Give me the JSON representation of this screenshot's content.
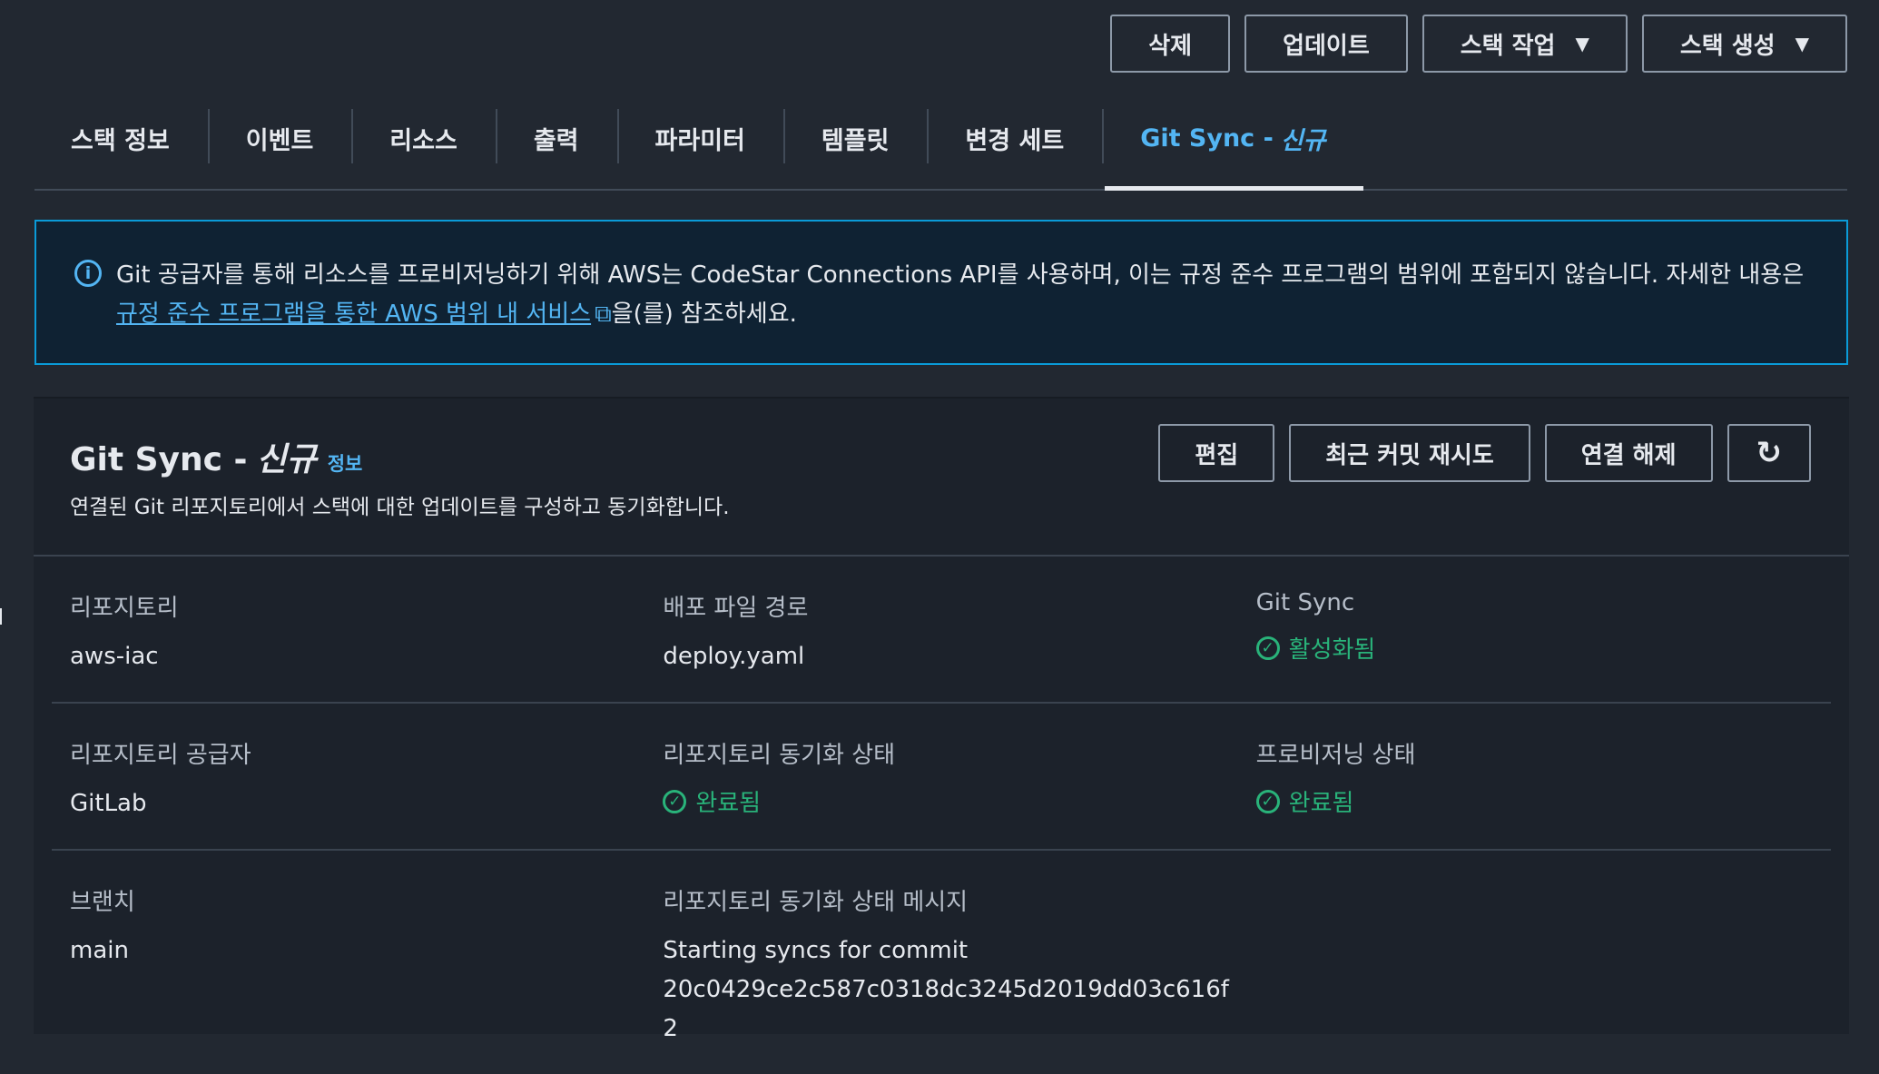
{
  "header_actions": {
    "delete": "삭제",
    "update": "업데이트",
    "stack_actions": "스택 작업",
    "create_stack": "스택 생성"
  },
  "tabs": [
    {
      "label": "스택 정보"
    },
    {
      "label": "이벤트"
    },
    {
      "label": "리소스"
    },
    {
      "label": "출력"
    },
    {
      "label": "파라미터"
    },
    {
      "label": "템플릿"
    },
    {
      "label": "변경 세트"
    },
    {
      "label": "Git Sync -",
      "badge": "신규"
    }
  ],
  "alert": {
    "text": "Git 공급자를 통해 리소스를 프로비저닝하기 위해 AWS는 CodeStar Connections API를 사용하며, 이는 규정 준수 프로그램의 범위에 포함되지 않습니다. 자세한 내용은",
    "link": "규정 준수 프로그램을 통한 AWS 범위 내 서비스",
    "suffix": "을(를) 참조하세요."
  },
  "panel": {
    "title": "Git Sync -",
    "title_badge": "신규",
    "info_link": "정보",
    "description": "연결된 Git 리포지토리에서 스택에 대한 업데이트를 구성하고 동기화합니다.",
    "actions": {
      "edit": "편집",
      "retry_last_commit": "최근 커밋 재시도",
      "disconnect": "연결 해제"
    }
  },
  "details": {
    "repository_label": "리포지토리",
    "repository_value": "aws-iac",
    "deploy_file_label": "배포 파일 경로",
    "deploy_file_value": "deploy.yaml",
    "git_sync_label": "Git Sync",
    "git_sync_value": "활성화됨",
    "provider_label": "리포지토리 공급자",
    "provider_value": "GitLab",
    "repo_sync_status_label": "리포지토리 동기화 상태",
    "repo_sync_status_value": "완료됨",
    "provisioning_status_label": "프로비저닝 상태",
    "provisioning_status_value": "완료됨",
    "branch_label": "브랜치",
    "branch_value": "main",
    "sync_message_label": "리포지토리 동기화 상태 메시지",
    "sync_message_line1": "Starting syncs for commit",
    "sync_message_line2": "20c0429ce2c587c0318dc3245d2019dd03c616f",
    "sync_message_line3": "2"
  },
  "colors": {
    "accent": "#53b5f3",
    "success": "#29b37a",
    "background": "#222831"
  }
}
